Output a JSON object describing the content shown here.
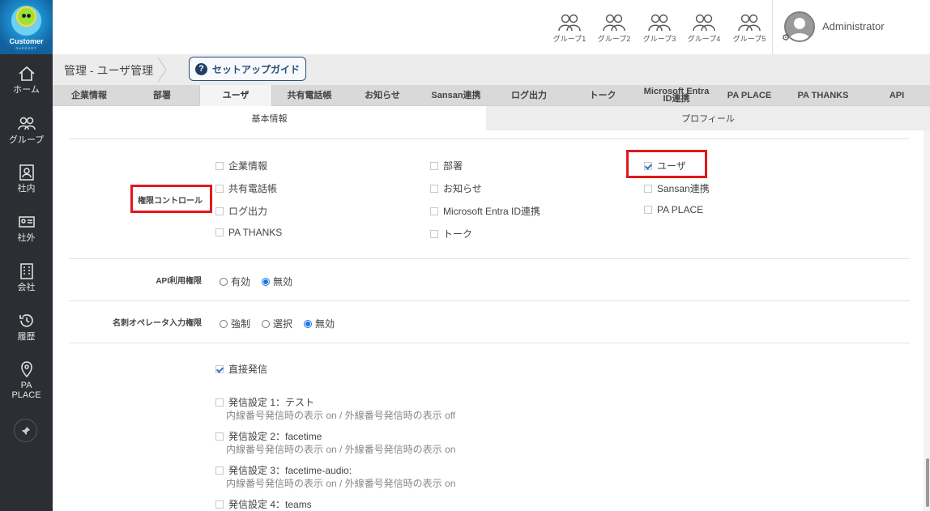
{
  "logo": {
    "line1": "Customer",
    "line2": "SUPPORT"
  },
  "sidebar": {
    "items": [
      {
        "label": "ホーム"
      },
      {
        "label": "グループ"
      },
      {
        "label": "社内"
      },
      {
        "label": "社外"
      },
      {
        "label": "会社"
      },
      {
        "label": "履歴"
      },
      {
        "label": "PA",
        "label2": "PLACE"
      }
    ]
  },
  "header": {
    "groups": [
      "グループ1",
      "グループ2",
      "グループ3",
      "グループ4",
      "グループ5"
    ],
    "user": "Administrator"
  },
  "breadcrumb": {
    "text": "管理 - ユーザ管理",
    "guide_button": "セットアップガイド"
  },
  "tabs": [
    {
      "label": "企業情報"
    },
    {
      "label": "部署"
    },
    {
      "label": "ユーザ"
    },
    {
      "label": "共有電話帳"
    },
    {
      "label": "お知らせ"
    },
    {
      "label": "Sansan連携"
    },
    {
      "label": "ログ出力"
    },
    {
      "label": "トーク"
    },
    {
      "label": "Microsoft Entra",
      "label2": "ID連携"
    },
    {
      "label": "PA PLACE"
    },
    {
      "label": "PA THANKS"
    },
    {
      "label": "API"
    }
  ],
  "subtabs": {
    "basic": "基本情報",
    "profile": "プロフィール"
  },
  "permission": {
    "label": "権限コントロール",
    "items": [
      {
        "label": "企業情報",
        "checked": false
      },
      {
        "label": "部署",
        "checked": false
      },
      {
        "label": "ユーザ",
        "checked": true
      },
      {
        "label": "共有電話帳",
        "checked": false
      },
      {
        "label": "お知らせ",
        "checked": false
      },
      {
        "label": "Sansan連携",
        "checked": false
      },
      {
        "label": "ログ出力",
        "checked": false
      },
      {
        "label": "Microsoft Entra ID連携",
        "checked": false
      },
      {
        "label": "PA PLACE",
        "checked": false
      },
      {
        "label": "PA THANKS",
        "checked": false
      },
      {
        "label": "トーク",
        "checked": false
      }
    ]
  },
  "api_permission": {
    "label": "API利用権限",
    "options": [
      {
        "label": "有効",
        "selected": false
      },
      {
        "label": "無効",
        "selected": true
      }
    ]
  },
  "card_input": {
    "label": "名刺オペレータ入力権限",
    "options": [
      {
        "label": "強制",
        "selected": false
      },
      {
        "label": "選択",
        "selected": false
      },
      {
        "label": "無効",
        "selected": true
      }
    ]
  },
  "calling": {
    "direct": {
      "label": "直接発信",
      "checked": true
    },
    "settings": [
      {
        "label": "発信設定 1：テスト",
        "note": "内線番号発信時の表示 on / 外線番号発信時の表示 off"
      },
      {
        "label": "発信設定 2：facetime",
        "note": "内線番号発信時の表示 on / 外線番号発信時の表示 on"
      },
      {
        "label": "発信設定 3：facetime-audio:",
        "note": "内線番号発信時の表示 on / 外線番号発信時の表示 on"
      },
      {
        "label": "発信設定 4：teams",
        "note": ""
      }
    ]
  },
  "colors": {
    "sidebar": "#2b2f33",
    "accent": "#1a73e8",
    "highlight": "#e0191b",
    "guide": "#2a4e78"
  }
}
